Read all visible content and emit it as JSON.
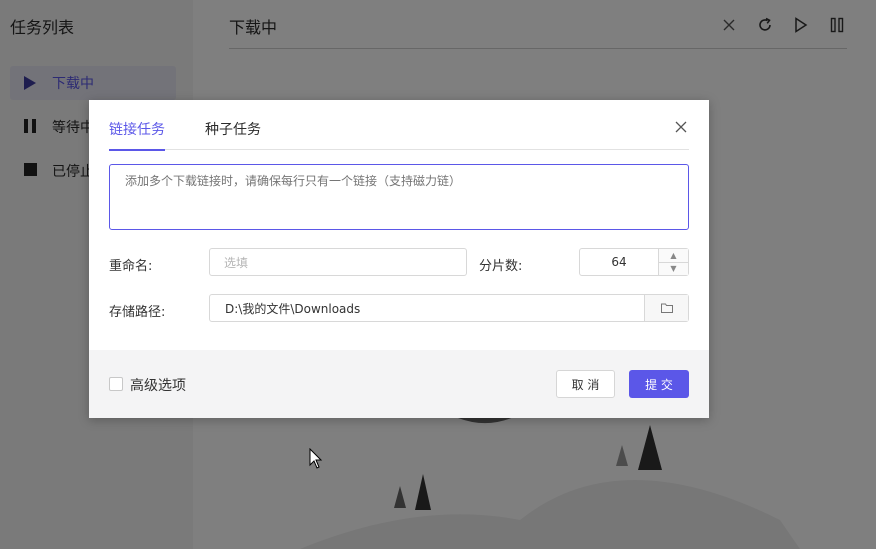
{
  "sidebar": {
    "title": "任务列表",
    "items": [
      {
        "label": "下载中",
        "icon": "play-icon",
        "active": true
      },
      {
        "label": "等待中",
        "icon": "pause-icon",
        "active": false
      },
      {
        "label": "已停止",
        "icon": "stop-icon",
        "active": false
      }
    ]
  },
  "main": {
    "title": "下载中",
    "toolbar": [
      "close-icon",
      "refresh-icon",
      "play-icon",
      "pause-icon"
    ]
  },
  "dialog": {
    "tabs": [
      {
        "label": "链接任务",
        "active": true
      },
      {
        "label": "种子任务",
        "active": false
      }
    ],
    "links_placeholder": "添加多个下载链接时，请确保每行只有一个链接（支持磁力链）",
    "rename_label": "重命名:",
    "rename_placeholder": "选填",
    "split_label": "分片数:",
    "split_value": "64",
    "path_label": "存储路径:",
    "path_value": "D:\\我的文件\\Downloads",
    "advanced_label": "高级选项",
    "cancel_label": "取 消",
    "submit_label": "提 交"
  },
  "colors": {
    "accent": "#5b57e8",
    "overlay": "rgba(0,0,0,0.5)"
  }
}
